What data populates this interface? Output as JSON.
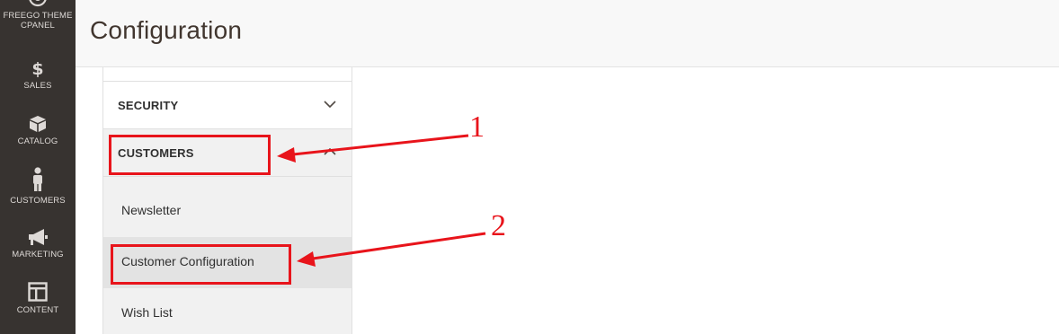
{
  "nav": {
    "items": [
      {
        "label": "FREEGO THEME CPANEL",
        "icon": "freego-icon"
      },
      {
        "label": "SALES",
        "icon": "dollar-icon"
      },
      {
        "label": "CATALOG",
        "icon": "box-icon"
      },
      {
        "label": "CUSTOMERS",
        "icon": "person-icon"
      },
      {
        "label": "MARKETING",
        "icon": "megaphone-icon"
      },
      {
        "label": "CONTENT",
        "icon": "layout-icon"
      }
    ],
    "freego_line1": "FREEGO THEME",
    "freego_line2": "CPANEL"
  },
  "header": {
    "title": "Configuration"
  },
  "config": {
    "sections": [
      {
        "title": "SECURITY",
        "state": "collapsed"
      },
      {
        "title": "CUSTOMERS",
        "state": "expanded"
      }
    ],
    "customers_items": [
      {
        "label": "Newsletter"
      },
      {
        "label": "Customer Configuration",
        "active": true
      },
      {
        "label": "Wish List"
      }
    ]
  },
  "annotations": {
    "labels": [
      "1",
      "2"
    ],
    "color": "#e8141b"
  },
  "colors": {
    "nav_bg": "#373330",
    "nav_text": "#ddd9d6",
    "header_bg": "#f8f8f8",
    "panel_bg": "#f1f1f1",
    "active_item_bg": "#e3e3e3"
  }
}
